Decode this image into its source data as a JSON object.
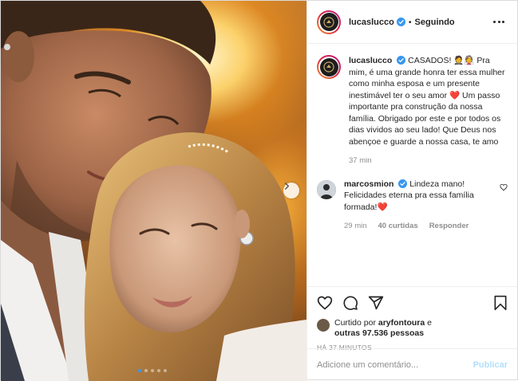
{
  "post": {
    "author": "lucaslucco",
    "follow_status": "Seguindo",
    "separator": "•",
    "caption_user": "lucaslucco",
    "caption_part1": "CASADOS! ",
    "caption_emoji": "🤵👰",
    "caption_part2": " Pra mim, é uma grande honra ter essa mulher como minha esposa e um presente inestimável ter o seu amor ",
    "caption_heart": "❤️",
    "caption_part3": " Um passo importante pra construção da nossa família. Obrigado por este e por todos os dias vividos ao seu lado! Que Deus nos abençoe e guarde a nossa casa, te amo",
    "caption_time": "37 min"
  },
  "comment": {
    "user": "marcosmion",
    "text": "Lindeza mano! Felicidades eterna pra essa família formada!",
    "heart": "❤️",
    "time": "29 min",
    "likes": "40 curtidas",
    "reply": "Responder"
  },
  "likes": {
    "prefix": "Curtido por ",
    "user": "aryfontoura",
    "middle": " e",
    "others": "outras 97.536 pessoas"
  },
  "time_ago": "HÁ 37 MINUTOS",
  "add_comment": {
    "placeholder": "Adicione um comentário...",
    "publish": "Publicar"
  },
  "carousel": {
    "total": 5,
    "active": 0
  },
  "colors": {
    "accent": "#3897f0",
    "verified": "#3897f0",
    "publish_disabled": "#b2dffc",
    "heart": "#ed4956"
  },
  "icons": [
    "verified-icon",
    "more-options-icon",
    "next-arrow-icon",
    "like-icon",
    "comment-icon",
    "share-icon",
    "save-icon",
    "heart-small-icon"
  ]
}
